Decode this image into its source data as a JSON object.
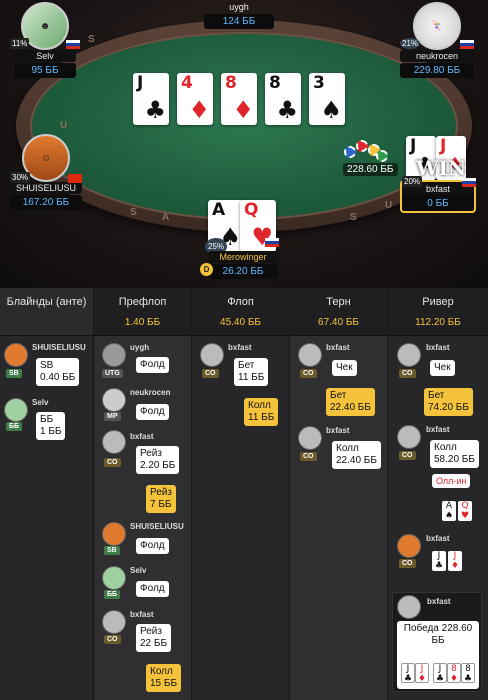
{
  "table": {
    "rail_letters": [
      "S",
      "U",
      "S",
      "A",
      "S",
      "U",
      "S"
    ],
    "board": [
      {
        "rank": "J",
        "suit": "♣",
        "color": "blk"
      },
      {
        "rank": "4",
        "suit": "♦",
        "color": "red"
      },
      {
        "rank": "8",
        "suit": "♦",
        "color": "red"
      },
      {
        "rank": "8",
        "suit": "♣",
        "color": "blk"
      },
      {
        "rank": "3",
        "suit": "♠",
        "color": "blk"
      }
    ],
    "pot": "228.60 ББ",
    "win_label": "WIN",
    "hero_cards": [
      {
        "rank": "A",
        "suit": "♠",
        "color": "blk"
      },
      {
        "rank": "Q",
        "suit": "♥",
        "color": "red"
      }
    ],
    "winner_cards": [
      {
        "rank": "J",
        "suit": "♣",
        "color": "blk"
      },
      {
        "rank": "J",
        "suit": "♦",
        "color": "red"
      }
    ]
  },
  "players": {
    "top": {
      "name": "uygh",
      "stack": "124 ББ"
    },
    "selv": {
      "name": "Selv",
      "stack": "95 ББ",
      "pct": "11%"
    },
    "neukrocen": {
      "name": "neukrocen",
      "stack": "229.80 ББ",
      "pct": "21%"
    },
    "shuiseliusu": {
      "name": "SHUISELIUSU",
      "stack": "167.20 ББ",
      "pct": "30%"
    },
    "bxfast": {
      "name": "bxfast",
      "stack": "0 ББ",
      "pct": "20%"
    },
    "merowinger": {
      "name": "Merowinger",
      "stack": "26.20 ББ",
      "pct": "25%",
      "badge": "D"
    }
  },
  "history": {
    "columns": [
      {
        "title": "Блайнды (анте)",
        "value": ""
      },
      {
        "title": "Префлоп",
        "value": "1.40 ББ"
      },
      {
        "title": "Флоп",
        "value": "45.40 ББ"
      },
      {
        "title": "Терн",
        "value": "67.40 ББ"
      },
      {
        "title": "Ривер",
        "value": "112.20 ББ"
      }
    ],
    "blinds": [
      {
        "name": "SHUISELIUSU",
        "pos": "SB",
        "action": "SB\n0.40 ББ"
      },
      {
        "name": "Selv",
        "pos": "ББ",
        "action": "ББ\n1 ББ"
      }
    ],
    "preflop": [
      {
        "name": "uygh",
        "pos": "UTG",
        "action": "Фолд"
      },
      {
        "name": "neukrocen",
        "pos": "MP",
        "action": "Фолд"
      },
      {
        "name": "bxfast",
        "pos": "CO",
        "action": "Рейз\n2.20 ББ"
      },
      {
        "name": "",
        "pos": "",
        "action": "Рейз\n7 ББ"
      },
      {
        "name": "SHUISELIUSU",
        "pos": "SB",
        "action": "Фолд"
      },
      {
        "name": "Selv",
        "pos": "ББ",
        "action": "Фолд"
      },
      {
        "name": "bxfast",
        "pos": "CO",
        "action": "Рейз\n22 ББ"
      },
      {
        "name": "",
        "pos": "",
        "action": "Колл\n15 ББ"
      }
    ],
    "flop": [
      {
        "name": "bxfast",
        "pos": "CO",
        "action": "Бет\n11 ББ"
      },
      {
        "name": "",
        "pos": "",
        "action": "Колл\n11 ББ"
      }
    ],
    "turn": [
      {
        "name": "bxfast",
        "pos": "CO",
        "action": "Чек"
      },
      {
        "name": "",
        "pos": "",
        "action": "Бет\n22.40 ББ"
      },
      {
        "name": "bxfast",
        "pos": "CO",
        "action": "Колл\n22.40 ББ"
      }
    ],
    "river": [
      {
        "name": "bxfast",
        "pos": "CO",
        "action": "Чек"
      },
      {
        "name": "",
        "pos": "",
        "action": "Бет\n74.20 ББ"
      },
      {
        "name": "bxfast",
        "pos": "CO",
        "action": "Колл\n58.20 ББ"
      },
      {
        "name": "",
        "pos": "",
        "action": "Олл-ин"
      },
      {
        "name": "bxfast",
        "pos": "CO",
        "action": ""
      }
    ],
    "win": {
      "name": "bxfast",
      "text": "Победа 228.60 ББ"
    }
  }
}
